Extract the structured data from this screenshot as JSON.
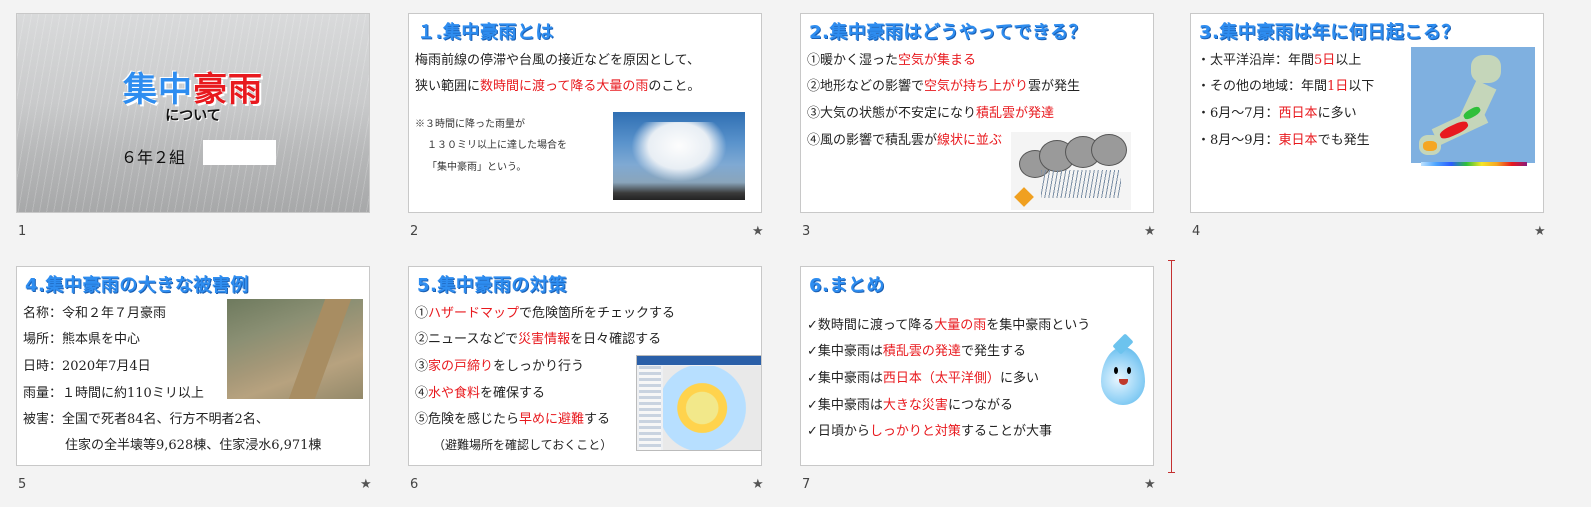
{
  "slides": [
    {
      "num": "1",
      "title_main_a": "集中",
      "title_main_b": "豪雨",
      "subtitle": "について",
      "class_label": "６年２組"
    },
    {
      "num": "2",
      "title": "１.集中豪雨とは",
      "l1": "梅雨前線の停滞や台風の接近などを原因として、",
      "l2a": "狭い範囲に",
      "l2b": "数時間に渡って降る大量の雨",
      "l2c": "のこと。",
      "n1": "※３時間に降った雨量が",
      "n2": "１３０ミリ以上に達した場合を",
      "n3": "「集中豪雨」という。"
    },
    {
      "num": "3",
      "title": "2.集中豪雨はどうやってできる？",
      "l1a": "①暖かく湿った",
      "l1b": "空気が集まる",
      "l2a": "②地形などの影響で",
      "l2b": "空気が持ち上がり",
      "l2c": "雲が発生",
      "l3a": "③大気の状態が不安定になり",
      "l3b": "積乱雲が発達",
      "l4a": "④風の影響で積乱雲が",
      "l4b": "線状に並ぶ"
    },
    {
      "num": "4",
      "title": "3.集中豪雨は年に何日起こる？",
      "l1a": "・太平洋沿岸：年間",
      "l1b": "5日",
      "l1c": "以上",
      "l2a": "・その他の地域：年間",
      "l2b": "1日",
      "l2c": "以下",
      "l3a": "・6月～7月：",
      "l3b": "西日本",
      "l3c": "に多い",
      "l4a": "・8月～9月：",
      "l4b": "東日本",
      "l4c": "でも発生"
    },
    {
      "num": "5",
      "title": "4.集中豪雨の大きな被害例",
      "l1": "名称：令和２年７月豪雨",
      "l2": "場所：熊本県を中心",
      "l3": "日時：2020年7月4日",
      "l4": "雨量：１時間に約110ミリ以上",
      "l5": "被害：全国で死者84名、行方不明者2名、",
      "l6": "住家の全半壊等9,628棟、住家浸水6,971棟"
    },
    {
      "num": "6",
      "title": "5.集中豪雨の対策",
      "l1a": "①",
      "l1b": "ハザードマップ",
      "l1c": "で危険箇所をチェックする",
      "l2a": "②ニュースなどで",
      "l2b": "災害情報",
      "l2c": "を日々確認する",
      "l3a": "③",
      "l3b": "家の戸締り",
      "l3c": "をしっかり行う",
      "l4a": "④",
      "l4b": "水や食料",
      "l4c": "を確保する",
      "l5a": "⑤危険を感じたら",
      "l5b": "早めに避難",
      "l5c": "する",
      "l6": "（避難場所を確認しておくこと）"
    },
    {
      "num": "7",
      "title": "6.まとめ",
      "l1a": "数時間に渡って降る",
      "l1b": "大量の雨",
      "l1c": "を集中豪雨という",
      "l2a": "集中豪雨は",
      "l2b": "積乱雲の発達",
      "l2c": "で発生する",
      "l3a": "集中豪雨は",
      "l3b": "西日本（太平洋側）",
      "l3c": "に多い",
      "l4a": "集中豪雨は",
      "l4b": "大きな災害",
      "l4c": "につながる",
      "l5a": "日頃から",
      "l5b": "しっかりと対策",
      "l5c": "することが大事"
    }
  ],
  "star": "★",
  "check": "✓",
  "colors": {
    "title_blue": "#2e8df0",
    "accent_red": "#e8191e"
  }
}
